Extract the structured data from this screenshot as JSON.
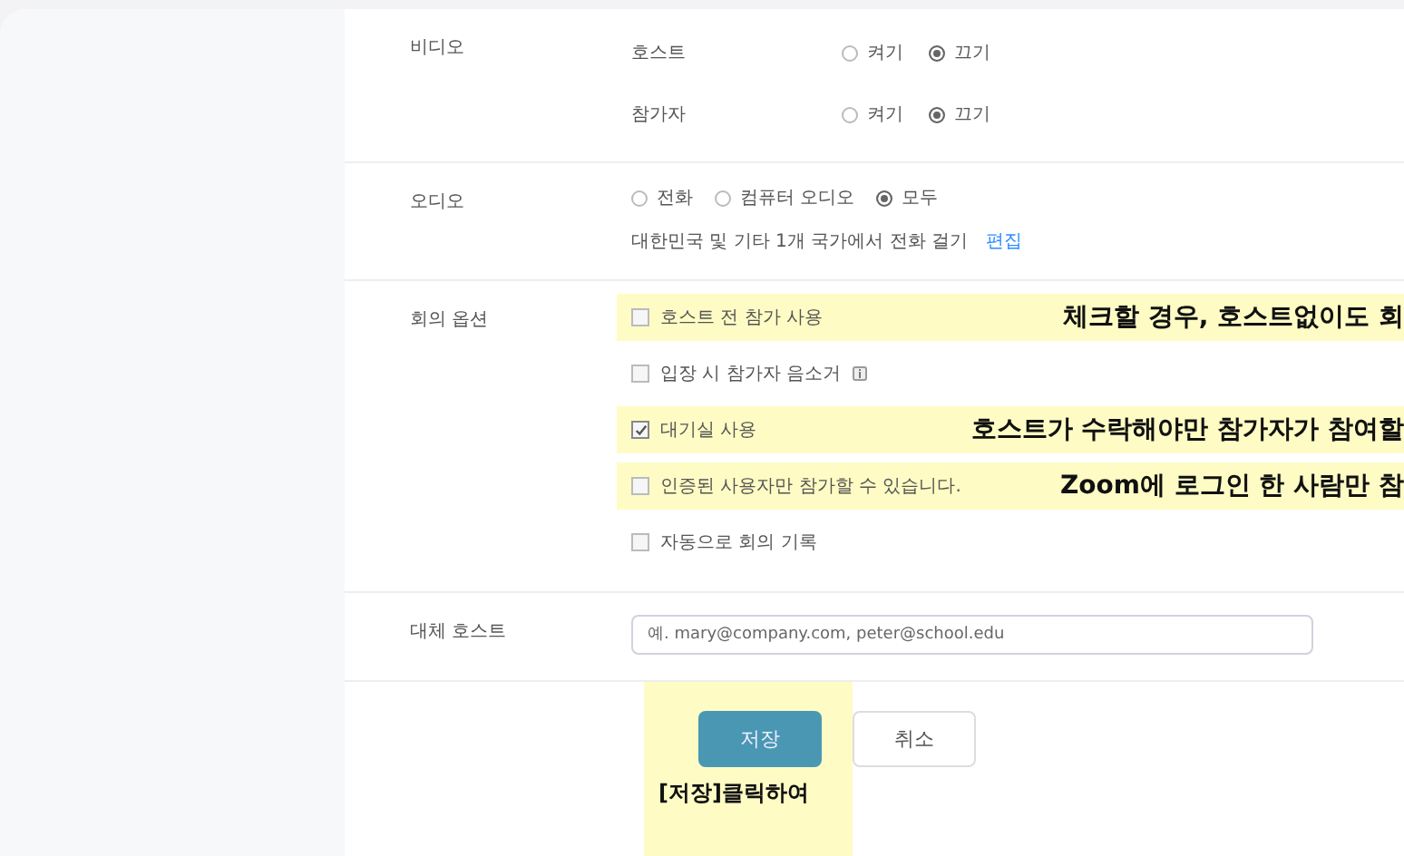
{
  "sections": [
    {
      "label": "비디오",
      "kind": "radio-rows",
      "rows": [
        {
          "label": "호스트",
          "options": [
            {
              "label": "켜기",
              "selected": false
            },
            {
              "label": "끄기",
              "selected": true
            }
          ]
        },
        {
          "label": "참가자",
          "options": [
            {
              "label": "켜기",
              "selected": false
            },
            {
              "label": "끄기",
              "selected": true
            }
          ]
        }
      ]
    },
    {
      "label": "오디오",
      "kind": "radio-inline",
      "options": [
        {
          "label": "전화",
          "selected": false
        },
        {
          "label": "컴퓨터 오디오",
          "selected": false
        },
        {
          "label": "모두",
          "selected": true
        }
      ],
      "note": "대한민국 및 기타 1개 국가에서 전화 걸기",
      "link": "편집"
    },
    {
      "label": "회의 옵션",
      "kind": "checkboxes",
      "items": [
        {
          "label": "호스트 전 참가 사용",
          "checked": false,
          "annotation": "체크할 경우, 호스트없이도 회"
        },
        {
          "label": "입장 시 참가자 음소거",
          "checked": false,
          "info": true
        },
        {
          "label": "대기실 사용",
          "checked": true,
          "annotation": "호스트가 수락해야만 참가자가 참여할"
        },
        {
          "label": "인증된 사용자만 참가할 수 있습니다.",
          "checked": false,
          "annotation": "Zoom에 로그인 한 사람만 참"
        },
        {
          "label": "자동으로 회의 기록",
          "checked": false
        }
      ]
    },
    {
      "label": "대체 호스트",
      "kind": "field",
      "placeholder": "예. mary@company.com, peter@school.edu"
    }
  ],
  "buttons": [
    {
      "label": "저장",
      "kind": "primary"
    },
    {
      "label": "취소",
      "kind": "secondary"
    }
  ],
  "button_annotation": "[저장]클릭하여"
}
